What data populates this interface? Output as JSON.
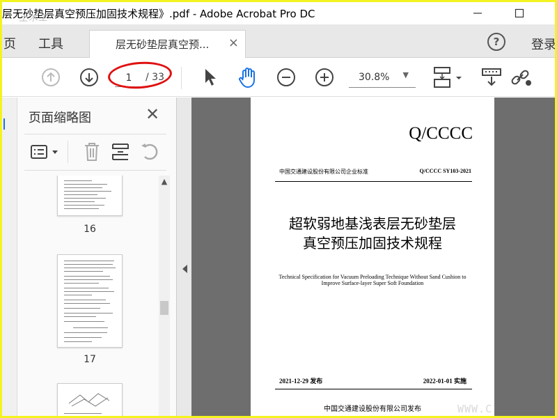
{
  "window": {
    "title": "层无砂垫层真空预压加固技术规程》.pdf - Adobe Acrobat Pro DC",
    "title_watermark": "土木工",
    "minimize_icon": "minimize-icon",
    "maximize_icon": "maximize-icon"
  },
  "tabs": {
    "home_label": "页",
    "tools_label": "工具",
    "document_tab_label": "层无砂垫层真空预...",
    "help_label": "?",
    "login_label": "登录"
  },
  "toolbar": {
    "page_current": "1",
    "page_total": "/ 33",
    "zoom": "30.8%",
    "annotation_color": "#e01010"
  },
  "thumbnails": {
    "panel_title": "页面缩略图",
    "pages": [
      "16",
      "17"
    ]
  },
  "document": {
    "standard_code": "Q/CCCC",
    "header_left": "中国交通建设股份有限公司企业标准",
    "header_right": "Q/CCCC SY103-2021",
    "title_line1": "超软弱地基浅表层无砂垫层",
    "title_line2": "真空预压加固技术规程",
    "title_en_line1": "Technical Specification for Vacuum Preloading Technique Without Sand Cushion to",
    "title_en_line2": "Improve Surface-layer Super Soft Foundation",
    "publish_date": "2021-12-29 发布",
    "effective_date": "2022-01-01 实施",
    "publisher": "中国交通建设股份有限公司发布"
  },
  "watermark_bottom": "WWW.C"
}
